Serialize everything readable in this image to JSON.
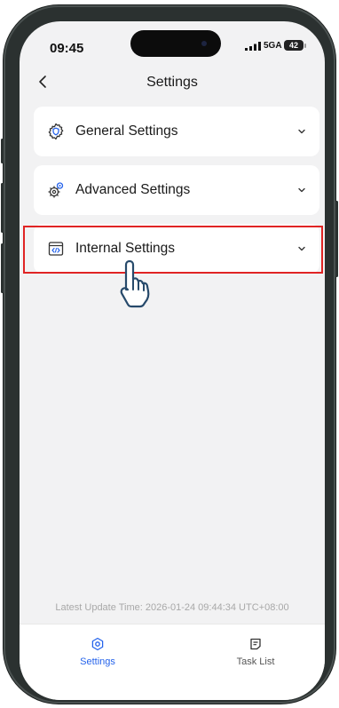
{
  "status_bar": {
    "time": "09:45",
    "network": "5GA",
    "battery": "42"
  },
  "nav": {
    "title": "Settings"
  },
  "menu": [
    {
      "label": "General Settings",
      "icon": "gear-shield-icon"
    },
    {
      "label": "Advanced Settings",
      "icon": "gears-icon"
    },
    {
      "label": "Internal Settings",
      "icon": "code-window-icon",
      "highlighted": true
    }
  ],
  "footer": {
    "update_text": "Latest Update Time: 2026-01-24 09:44:34 UTC+08:00"
  },
  "tabs": [
    {
      "label": "Settings",
      "icon": "settings-icon",
      "active": true
    },
    {
      "label": "Task List",
      "icon": "task-list-icon",
      "active": false
    }
  ],
  "colors": {
    "accent": "#2563eb",
    "highlight": "#e02424",
    "background": "#f2f2f3"
  }
}
